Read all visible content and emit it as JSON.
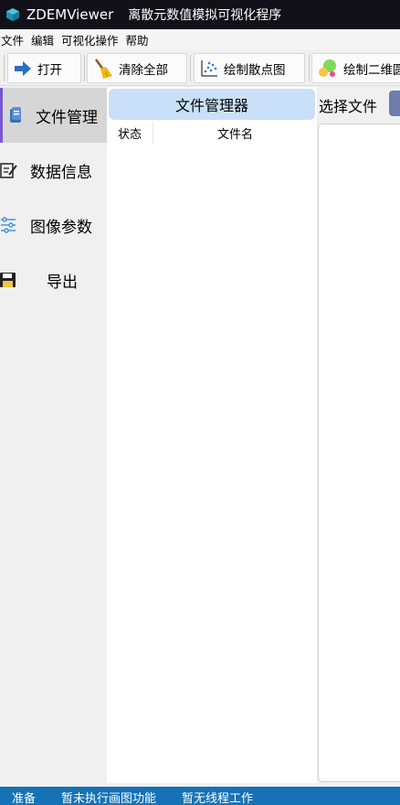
{
  "window": {
    "app_name": "ZDEMViewer",
    "subtitle": "离散元数值模拟可视化程序"
  },
  "menu": [
    "文件",
    "编辑",
    "可视化操作",
    "帮助"
  ],
  "toolbar": {
    "open": "打开",
    "clear_all": "清除全部",
    "scatter": "绘制散点图",
    "circle2d": "绘制二维圆"
  },
  "sidebar": {
    "items": [
      {
        "label": "文件管理",
        "icon": "document-icon",
        "active": true
      },
      {
        "label": "数据信息",
        "icon": "edit-note-icon",
        "active": false
      },
      {
        "label": "图像参数",
        "icon": "sliders-icon",
        "active": false
      },
      {
        "label": "导出",
        "icon": "save-icon",
        "active": false
      }
    ]
  },
  "file_manager": {
    "title": "文件管理器",
    "columns": [
      "状态",
      "文件名"
    ]
  },
  "right_panel": {
    "select_file_label": "选择文件"
  },
  "status": {
    "ready": "准备",
    "plot_status": "暂未执行画图功能",
    "thread_status": "暂无线程工作"
  },
  "colors": {
    "titlebar": "#12111a",
    "accent": "#7a55d4",
    "panel_header": "#c9e0f8",
    "statusbar": "#1572b6",
    "select_button": "#6f7cac"
  }
}
